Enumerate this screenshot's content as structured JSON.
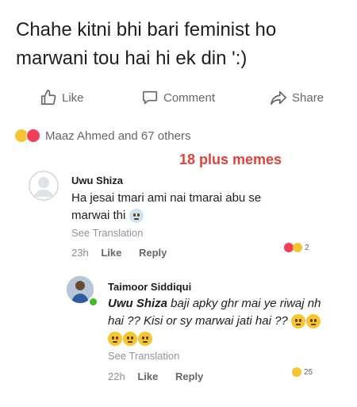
{
  "post": {
    "text": "Chahe kitni bhi bari feminist ho\nmarwani tou hai hi ek din ':)"
  },
  "actions": {
    "like": "Like",
    "comment": "Comment",
    "share": "Share"
  },
  "reactions_summary": {
    "text": "Maaz Ahmed and 67 others"
  },
  "watermark": "18 plus memes",
  "comment1": {
    "author": "Uwu Shiza",
    "body": "Ha jesai tmari ami nai tmarai abu se marwai thi",
    "see_translation": "See Translation",
    "time": "23h",
    "like": "Like",
    "reply": "Reply",
    "reaction_count": "2"
  },
  "reply1": {
    "author": "Taimoor Siddiqui",
    "mention": "Uwu Shiza",
    "body": " baji apky ghr mai ye riwaj nh hai ?? Kisi or sy marwai jati hai ??",
    "see_translation": "See Translation",
    "time": "22h",
    "like": "Like",
    "reply": "Reply",
    "reaction_count": "25"
  },
  "colors": {
    "watermark": "#e4413a",
    "secondary_text": "#65676b",
    "haha": "#f7c531",
    "love": "#f33e58"
  }
}
